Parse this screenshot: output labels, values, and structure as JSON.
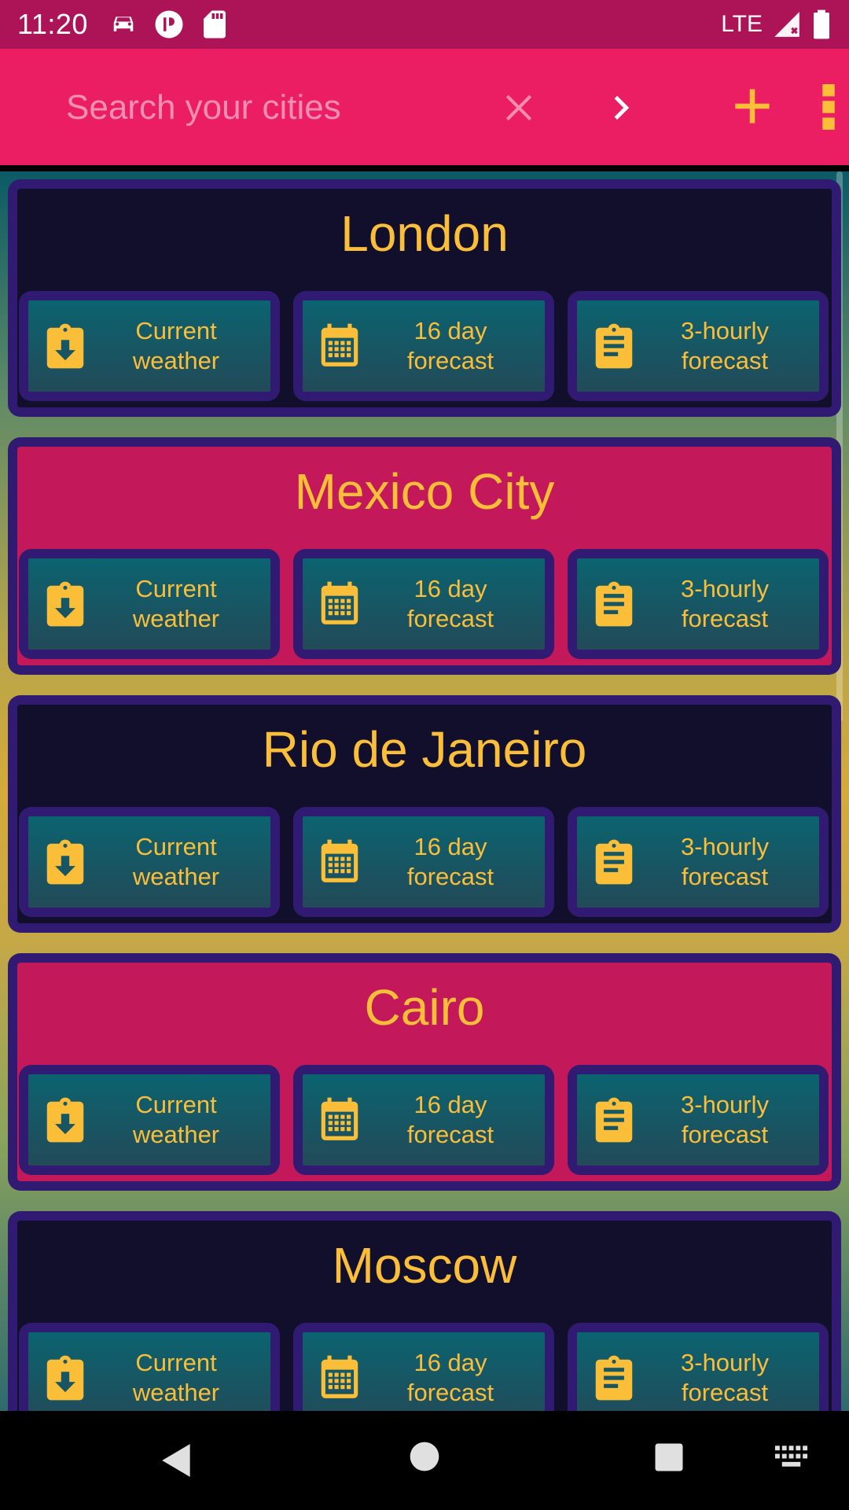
{
  "status_bar": {
    "time": "11:20",
    "network": "LTE",
    "icons": [
      "car-icon",
      "app-icon",
      "sd-card-icon",
      "signal-icon",
      "battery-icon"
    ]
  },
  "app_bar": {
    "search_placeholder": "Search your cities",
    "icons": {
      "clear": "close-icon",
      "go": "chevron-right-icon",
      "add": "plus-icon",
      "more": "more-vert-icon"
    },
    "colors": {
      "accent": "#fbbe38",
      "bar": "#ec1e63",
      "status": "#ad1457"
    }
  },
  "cities": [
    {
      "name": "London",
      "style": "dark",
      "actions": [
        {
          "label": "Current\nweather",
          "icon": "clipboard-download-icon"
        },
        {
          "label": "16 day\nforecast",
          "icon": "calendar-icon"
        },
        {
          "label": "3-hourly\nforecast",
          "icon": "clipboard-list-icon"
        }
      ]
    },
    {
      "name": "Mexico City",
      "style": "pink",
      "actions": [
        {
          "label": "Current\nweather",
          "icon": "clipboard-download-icon"
        },
        {
          "label": "16 day\nforecast",
          "icon": "calendar-icon"
        },
        {
          "label": "3-hourly\nforecast",
          "icon": "clipboard-list-icon"
        }
      ]
    },
    {
      "name": "Rio de Janeiro",
      "style": "dark",
      "actions": [
        {
          "label": "Current\nweather",
          "icon": "clipboard-download-icon"
        },
        {
          "label": "16 day\nforecast",
          "icon": "calendar-icon"
        },
        {
          "label": "3-hourly\nforecast",
          "icon": "clipboard-list-icon"
        }
      ]
    },
    {
      "name": "Cairo",
      "style": "pink",
      "actions": [
        {
          "label": "Current\nweather",
          "icon": "clipboard-download-icon"
        },
        {
          "label": "16 day\nforecast",
          "icon": "calendar-icon"
        },
        {
          "label": "3-hourly\nforecast",
          "icon": "clipboard-list-icon"
        }
      ]
    },
    {
      "name": "Moscow",
      "style": "dark",
      "actions": [
        {
          "label": "Current\nweather",
          "icon": "clipboard-download-icon"
        },
        {
          "label": "16 day\nforecast",
          "icon": "calendar-icon"
        },
        {
          "label": "3-hourly\nforecast",
          "icon": "clipboard-list-icon"
        }
      ]
    }
  ],
  "nav_bar": {
    "icons": [
      "back-icon",
      "home-icon",
      "recents-icon",
      "keyboard-icon"
    ]
  }
}
